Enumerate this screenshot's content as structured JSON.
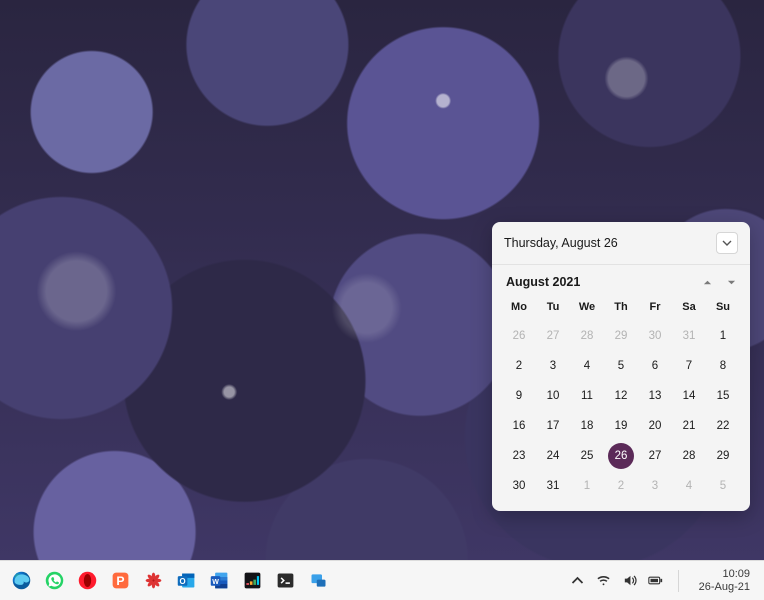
{
  "calendar": {
    "header_title": "Thursday, August 26",
    "month_title": "August 2021",
    "weekdays": [
      "Mo",
      "Tu",
      "We",
      "Th",
      "Fr",
      "Sa",
      "Su"
    ],
    "weeks": [
      [
        {
          "n": 26,
          "out": true
        },
        {
          "n": 27,
          "out": true
        },
        {
          "n": 28,
          "out": true
        },
        {
          "n": 29,
          "out": true
        },
        {
          "n": 30,
          "out": true
        },
        {
          "n": 31,
          "out": true
        },
        {
          "n": 1
        }
      ],
      [
        {
          "n": 2
        },
        {
          "n": 3
        },
        {
          "n": 4
        },
        {
          "n": 5
        },
        {
          "n": 6
        },
        {
          "n": 7
        },
        {
          "n": 8
        }
      ],
      [
        {
          "n": 9
        },
        {
          "n": 10
        },
        {
          "n": 11
        },
        {
          "n": 12
        },
        {
          "n": 13
        },
        {
          "n": 14
        },
        {
          "n": 15
        }
      ],
      [
        {
          "n": 16
        },
        {
          "n": 17
        },
        {
          "n": 18
        },
        {
          "n": 19
        },
        {
          "n": 20
        },
        {
          "n": 21
        },
        {
          "n": 22
        }
      ],
      [
        {
          "n": 23
        },
        {
          "n": 24
        },
        {
          "n": 25
        },
        {
          "n": 26,
          "today": true
        },
        {
          "n": 27
        },
        {
          "n": 28
        },
        {
          "n": 29
        }
      ],
      [
        {
          "n": 30
        },
        {
          "n": 31
        },
        {
          "n": 1,
          "out": true
        },
        {
          "n": 2,
          "out": true
        },
        {
          "n": 3,
          "out": true
        },
        {
          "n": 4,
          "out": true
        },
        {
          "n": 5,
          "out": true
        }
      ]
    ]
  },
  "taskbar": {
    "apps": [
      {
        "name": "edge",
        "title": "Microsoft Edge"
      },
      {
        "name": "whatsapp",
        "title": "WhatsApp"
      },
      {
        "name": "opera",
        "title": "Opera"
      },
      {
        "name": "p-app",
        "title": "P app"
      },
      {
        "name": "flower-app",
        "title": "App"
      },
      {
        "name": "outlook",
        "title": "Outlook"
      },
      {
        "name": "word",
        "title": "Word"
      },
      {
        "name": "deezer",
        "title": "Deezer"
      },
      {
        "name": "terminal",
        "title": "Terminal"
      },
      {
        "name": "misc-app",
        "title": "App"
      }
    ],
    "clock": {
      "time": "10:09",
      "date": "26-Aug-21"
    }
  }
}
